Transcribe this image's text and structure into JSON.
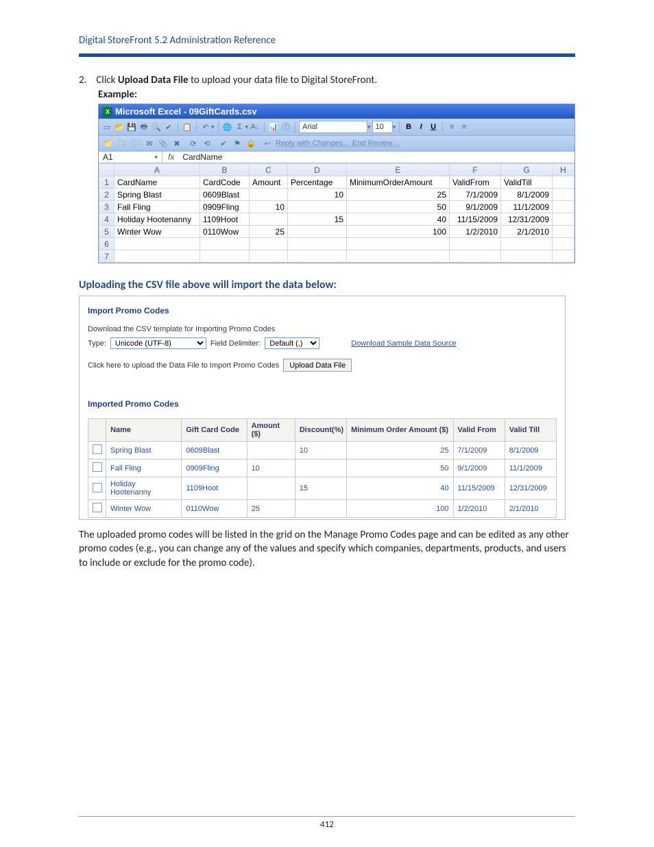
{
  "doc": {
    "header": "Digital StoreFront 5.2 Administration Reference",
    "step_num": "2.",
    "step_text_prefix": "Click ",
    "step_text_bold": "Upload Data File",
    "step_text_suffix": " to upload your data file to Digital StoreFront.",
    "example_label": "Example:",
    "sub_heading": "Uploading the CSV file above will import the data below:",
    "tail_para": "The uploaded promo codes will be listed in the grid on the Manage Promo Codes page and can be edited as any other promo codes (e.g., you can change any of the values and specify which companies, departments, products, and users to include or exclude for the promo code).",
    "page_num": "412"
  },
  "excel": {
    "title": "Microsoft Excel - 09GiftCards.csv",
    "font_name": "Arial",
    "font_size": "10",
    "review_text": "Reply with Changes…   End Review…",
    "name_box": "A1",
    "fbar_value": "CardName",
    "cols": [
      "A",
      "B",
      "C",
      "D",
      "E",
      "F",
      "G",
      "H"
    ],
    "header_row": [
      "CardName",
      "CardCode",
      "Amount",
      "Percentage",
      "MinimumOrderAmount",
      "ValidFrom",
      "ValidTill",
      ""
    ],
    "rows": [
      {
        "n": "2",
        "cells": [
          "Spring Blast",
          "0609Blast",
          "",
          "10",
          "25",
          "7/1/2009",
          "8/1/2009",
          ""
        ]
      },
      {
        "n": "3",
        "cells": [
          "Fall Fling",
          "0909Fling",
          "10",
          "",
          "50",
          "9/1/2009",
          "11/1/2009",
          ""
        ]
      },
      {
        "n": "4",
        "cells": [
          "Holiday Hootenanny",
          "1109Hoot",
          "",
          "15",
          "40",
          "11/15/2009",
          "12/31/2009",
          ""
        ]
      },
      {
        "n": "5",
        "cells": [
          "Winter Wow",
          "0110Wow",
          "25",
          "",
          "100",
          "1/2/2010",
          "2/1/2010",
          ""
        ]
      },
      {
        "n": "6",
        "cells": [
          "",
          "",
          "",
          "",
          "",
          "",
          "",
          ""
        ]
      },
      {
        "n": "7",
        "cells": [
          "",
          "",
          "",
          "",
          "",
          "",
          "",
          ""
        ]
      }
    ]
  },
  "import": {
    "title": "Import Promo Codes",
    "download_text": "Download the CSV template for Importing Promo Codes",
    "type_label": "Type:",
    "type_value": "Unicode (UTF-8)",
    "fd_label": "Field Delimiter:",
    "fd_value": "Default (,)",
    "sample_link": "Download Sample Data Source",
    "upload_text": "Click here to upload the Data File to Import Promo Codes",
    "upload_btn": "Upload Data File",
    "imported_title": "Imported Promo Codes",
    "headers": [
      "",
      "Name",
      "Gift Card Code",
      "Amount ($)",
      "Discount(%)",
      "Minimum Order Amount ($)",
      "Valid From",
      "Valid Till"
    ],
    "rows": [
      {
        "name": "Spring Blast",
        "code": "0609Blast",
        "amount": "",
        "discount": "10",
        "moa": "25",
        "from": "7/1/2009",
        "till": "8/1/2009"
      },
      {
        "name": "Fall Fling",
        "code": "0909Fling",
        "amount": "10",
        "discount": "",
        "moa": "50",
        "from": "9/1/2009",
        "till": "11/1/2009"
      },
      {
        "name": "Holiday Hootenanny",
        "code": "1109Hoot",
        "amount": "",
        "discount": "15",
        "moa": "40",
        "from": "11/15/2009",
        "till": "12/31/2009"
      },
      {
        "name": "Winter Wow",
        "code": "0110Wow",
        "amount": "25",
        "discount": "",
        "moa": "100",
        "from": "1/2/2010",
        "till": "2/1/2010"
      }
    ]
  }
}
